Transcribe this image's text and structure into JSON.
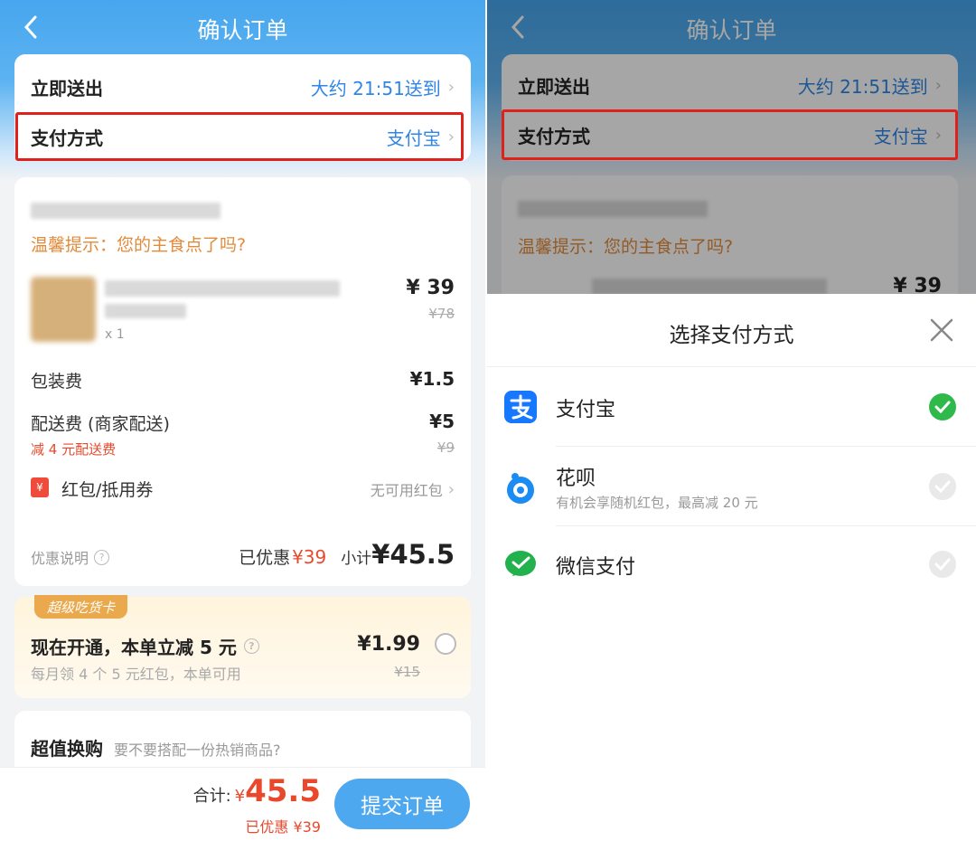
{
  "left": {
    "nav": {
      "title": "确认订单"
    },
    "delivery": {
      "label": "立即送出",
      "value": "大约 21:51送到"
    },
    "payment": {
      "label": "支付方式",
      "value": "支付宝"
    },
    "order": {
      "tip": "温馨提示：您的主食点了吗?",
      "item": {
        "qty": "x 1",
        "price": "¥ 39",
        "orig_price": "¥78"
      },
      "packaging": {
        "label": "包装费",
        "value": "¥1.5"
      },
      "delivery_fee": {
        "label": "配送费 (商家配送)",
        "value": "¥5",
        "discount_note": "减 4 元配送费",
        "orig_value": "¥9"
      },
      "coupon": {
        "icon_text": "¥",
        "label": "红包/抵用券",
        "value": "无可用红包"
      },
      "summary": {
        "promo_label": "优惠说明",
        "saved_prefix": "已优惠",
        "saved_value": "¥39",
        "subtotal_prefix": "小计",
        "subtotal_value": "¥45.5"
      }
    },
    "vip": {
      "tag": "超级吃货卡",
      "title": "现在开通，本单立减 5 元",
      "sub": "每月领 4 个 5 元红包，本单可用",
      "price": "¥1.99",
      "orig_price": "¥15"
    },
    "addon": {
      "title": "超值换购",
      "sub": "要不要搭配一份热销商品?"
    },
    "bottom": {
      "total_label": "合计:",
      "total_symbol": "¥",
      "total_value": "45.5",
      "saved": "已优惠 ¥39",
      "submit": "提交订单"
    }
  },
  "right": {
    "nav": {
      "title": "确认订单"
    },
    "delivery": {
      "label": "立即送出",
      "value": "大约 21:51送到"
    },
    "payment": {
      "label": "支付方式",
      "value": "支付宝"
    },
    "tip": "温馨提示：您的主食点了吗?",
    "peek_price": "¥ 39",
    "sheet": {
      "title": "选择支付方式",
      "options": [
        {
          "name": "支付宝",
          "sub": "",
          "icon": "alipay-icon",
          "selected": true
        },
        {
          "name": "花呗",
          "sub": "有机会享随机红包，最高减 20 元",
          "icon": "huabei-icon",
          "selected": false
        },
        {
          "name": "微信支付",
          "sub": "",
          "icon": "wechat-pay-icon",
          "selected": false
        }
      ]
    }
  },
  "colors": {
    "brand_blue": "#47a6ee",
    "link_blue": "#2f86e6",
    "warn_orange": "#e28a3a",
    "price_red": "#e8492d",
    "highlight_red": "#e0201b",
    "check_green": "#2fb94a"
  }
}
